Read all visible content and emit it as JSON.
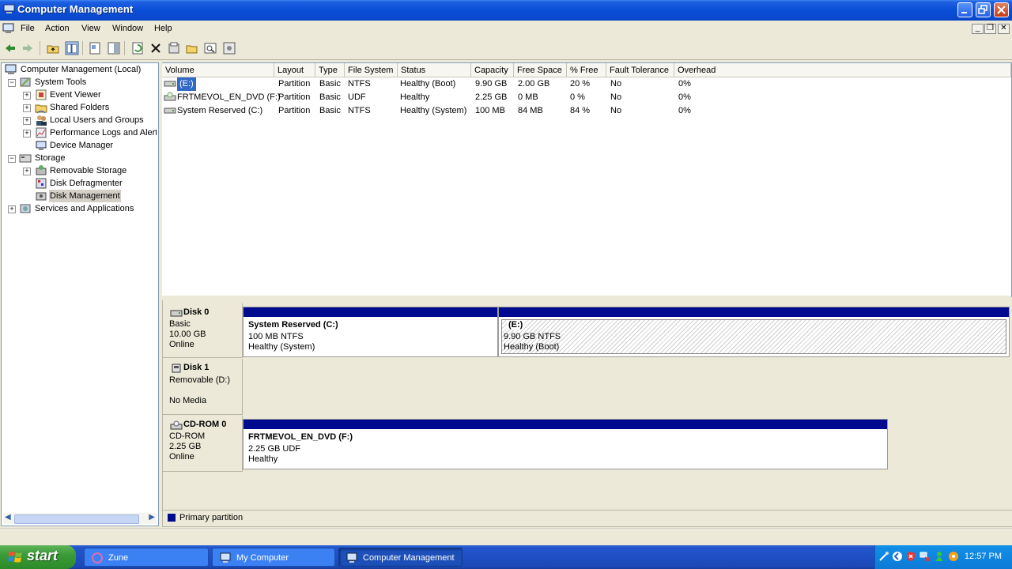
{
  "window": {
    "title": "Computer Management",
    "caption_buttons": [
      "minimize-icon",
      "restore-icon",
      "close-icon"
    ]
  },
  "menubar": {
    "items": [
      "File",
      "Action",
      "View",
      "Window",
      "Help"
    ]
  },
  "toolbar": {
    "icons": [
      "back-arrow-icon",
      "forward-arrow-icon",
      "up-one-level-icon",
      "show-hide-tree-icon",
      "properties-icon",
      "help-pane-icon",
      "refresh-icon",
      "delete-icon",
      "properties-sheet-icon",
      "open-icon",
      "search-icon",
      "disk-settings-icon"
    ]
  },
  "tree": {
    "root": "Computer Management (Local)",
    "system_tools": "System Tools",
    "event_viewer": "Event Viewer",
    "shared_folders": "Shared Folders",
    "local_users": "Local Users and Groups",
    "perf_logs": "Performance Logs and Alerts",
    "device_manager": "Device Manager",
    "storage": "Storage",
    "removable_storage": "Removable Storage",
    "disk_defrag": "Disk Defragmenter",
    "disk_mgmt": "Disk Management",
    "services": "Services and Applications"
  },
  "volume_table": {
    "columns": [
      "Volume",
      "Layout",
      "Type",
      "File System",
      "Status",
      "Capacity",
      "Free Space",
      "% Free",
      "Fault Tolerance",
      "Overhead"
    ],
    "rows": [
      [
        "(E:)",
        "Partition",
        "Basic",
        "NTFS",
        "Healthy (Boot)",
        "9.90 GB",
        "2.00 GB",
        "20 %",
        "No",
        "0%"
      ],
      [
        "FRTMEVOL_EN_DVD (F:)",
        "Partition",
        "Basic",
        "UDF",
        "Healthy",
        "2.25 GB",
        "0 MB",
        "0 %",
        "No",
        "0%"
      ],
      [
        "System Reserved (C:)",
        "Partition",
        "Basic",
        "NTFS",
        "Healthy (System)",
        "100 MB",
        "84 MB",
        "84 %",
        "No",
        "0%"
      ]
    ]
  },
  "disks": {
    "disk0": {
      "name": "Disk 0",
      "type": "Basic",
      "size": "10.00 GB",
      "state": "Online",
      "partitions": [
        {
          "title": "System Reserved  (C:)",
          "line1": "100 MB NTFS",
          "line2": "Healthy (System)"
        },
        {
          "title": "(E:)",
          "line1": "9.90 GB NTFS",
          "line2": "Healthy (Boot)"
        }
      ]
    },
    "disk1": {
      "name": "Disk 1",
      "type": "Removable (D:)",
      "state": "No Media"
    },
    "cdrom0": {
      "name": "CD-ROM 0",
      "type": "CD-ROM",
      "size": "2.25 GB",
      "state": "Online",
      "partition": {
        "title": "FRTMEVOL_EN_DVD  (F:)",
        "line1": "2.25 GB UDF",
        "line2": "Healthy"
      }
    }
  },
  "legend": {
    "primary": "Primary partition",
    "primary_color": "#000a8f"
  },
  "taskbar": {
    "start": "start",
    "tasks": [
      "Zune",
      "My Computer",
      "Computer Management"
    ],
    "clock": "12:57 PM"
  }
}
